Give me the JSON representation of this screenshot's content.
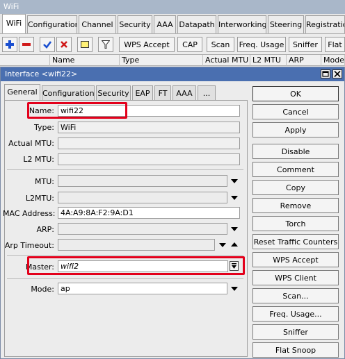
{
  "outer": {
    "title": "WiFi",
    "tabs": [
      "WiFi",
      "Configuration",
      "Channel",
      "Security",
      "AAA",
      "Datapath",
      "Interworking",
      "Steering",
      "Registration"
    ],
    "toolbar": {
      "wps_accept": "WPS Accept",
      "cap": "CAP",
      "scan": "Scan",
      "freq_usage": "Freq. Usage",
      "sniffer": "Sniffer",
      "flat": "Flat"
    },
    "columns": [
      "Name",
      "Type",
      "Actual MTU",
      "L2 MTU",
      "ARP",
      "Mode"
    ]
  },
  "dialog": {
    "title": "Interface <wifi22>",
    "tabs": [
      "General",
      "Configuration",
      "Security",
      "EAP",
      "FT",
      "AAA",
      "..."
    ],
    "fields": {
      "name": {
        "label": "Name:",
        "value": "wifi22"
      },
      "type": {
        "label": "Type:",
        "value": "WiFi"
      },
      "actual_mtu": {
        "label": "Actual MTU:",
        "value": ""
      },
      "l2_mtu": {
        "label": "L2 MTU:",
        "value": ""
      },
      "mtu": {
        "label": "MTU:",
        "value": ""
      },
      "l2mtu": {
        "label": "L2MTU:",
        "value": ""
      },
      "mac_address": {
        "label": "MAC Address:",
        "value": "4A:A9:8A:F2:9A:D1"
      },
      "arp": {
        "label": "ARP:",
        "value": ""
      },
      "arp_timeout": {
        "label": "Arp Timeout:",
        "value": ""
      },
      "master": {
        "label": "Master:",
        "value": "wifi2"
      },
      "mode": {
        "label": "Mode:",
        "value": "ap"
      }
    },
    "buttons": {
      "ok": "OK",
      "cancel": "Cancel",
      "apply": "Apply",
      "disable": "Disable",
      "comment": "Comment",
      "copy": "Copy",
      "remove": "Remove",
      "torch": "Torch",
      "reset_traffic_counters": "Reset Traffic Counters",
      "wps_accept": "WPS Accept",
      "wps_client": "WPS Client",
      "scan": "Scan...",
      "freq_usage": "Freq. Usage...",
      "sniffer": "Sniffer",
      "flat_snoop": "Flat Snoop"
    }
  },
  "colors": {
    "highlight": "#e3001b",
    "dialog_title_bar": "#4a6fb0",
    "add_icon": "#1a4fd0",
    "remove_icon": "#d01a1a"
  },
  "icons": [
    "add-icon",
    "remove-icon",
    "enable-check-icon",
    "disable-x-icon",
    "comment-icon",
    "filter-icon"
  ]
}
